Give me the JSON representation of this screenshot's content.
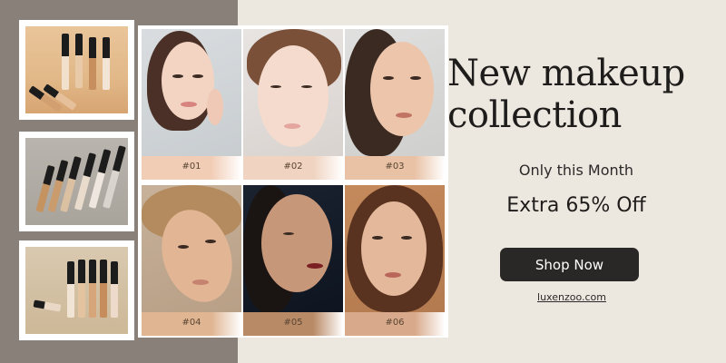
{
  "headline": {
    "line1": "New makeup",
    "line2": "collection"
  },
  "subheading": "Only this Month",
  "offer": "Extra 65% Off",
  "cta_label": "Shop Now",
  "website": "luxenzoo.com",
  "shades": [
    {
      "label": "#01",
      "swatch_color": "#f1cdb6"
    },
    {
      "label": "#02",
      "swatch_color": "#f0d3c0"
    },
    {
      "label": "#03",
      "swatch_color": "#e9c2a6"
    },
    {
      "label": "#04",
      "swatch_color": "#e0b592"
    },
    {
      "label": "#05",
      "swatch_color": "#b98a66"
    },
    {
      "label": "#06",
      "swatch_color": "#d8a98a"
    }
  ],
  "colors": {
    "background": "#ede8df",
    "left_band": "#898079",
    "button": "#2a2827",
    "text": "#1f1d1c"
  }
}
